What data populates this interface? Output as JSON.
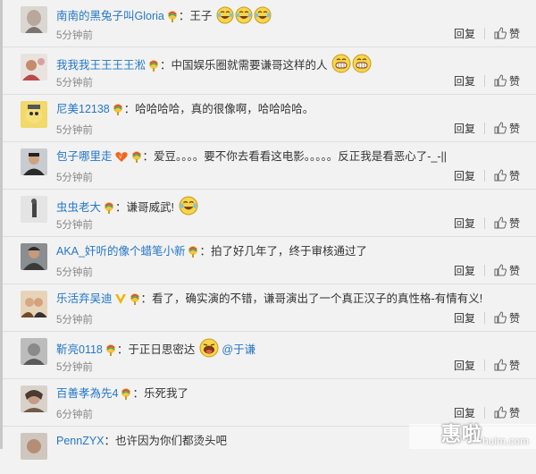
{
  "comments": [
    {
      "user": "南南的黑兔子叫Gloria",
      "text": "王子",
      "emojis": 3,
      "time": "5分钟前",
      "reply": "回复",
      "like": "赞"
    },
    {
      "user": "我我我王王王王淞",
      "text": "中国娱乐圈就需要谦哥这样的人",
      "emojis": 2,
      "time": "5分钟前",
      "reply": "回复",
      "like": "赞"
    },
    {
      "user": "尼美12138",
      "text": "哈哈哈哈，真的很像啊，哈哈哈哈。",
      "time": "5分钟前",
      "reply": "回复",
      "like": "赞"
    },
    {
      "user": "包子哪里走",
      "text": "爱豆。。。。要不你去看看这电影。。。。。反正我是看恶心了-_-||",
      "time": "5分钟前",
      "reply": "回复",
      "like": "赞"
    },
    {
      "user": "虫虫老大",
      "text": "谦哥威武!",
      "emojis": 1,
      "time": "5分钟前",
      "reply": "回复",
      "like": "赞"
    },
    {
      "user": "AKA_奸听的像个蜡笔小新",
      "text": "拍了好几年了，终于审核通过了",
      "time": "5分钟前",
      "reply": "回复",
      "like": "赞"
    },
    {
      "user": "乐活弃吴迪",
      "text": "看了，确实演的不错，谦哥演出了一个真正汉子的真性格-有情有义!",
      "time": "5分钟前",
      "reply": "回复",
      "like": "赞"
    },
    {
      "user": "靳亮0118",
      "text": "于正日思密达",
      "mention": "@于谦",
      "emojis": 1,
      "time": "5分钟前",
      "reply": "回复",
      "like": "赞"
    },
    {
      "user": "百善孝為先4",
      "text": "乐死我了",
      "time": "6分钟前",
      "reply": "回复",
      "like": "赞"
    },
    {
      "user": "PennZYX",
      "text": "也许因为你们都烫头吧",
      "time": "",
      "reply": "",
      "like": ""
    }
  ],
  "watermark": {
    "text": "惠啦",
    "sub": "huim.com"
  }
}
